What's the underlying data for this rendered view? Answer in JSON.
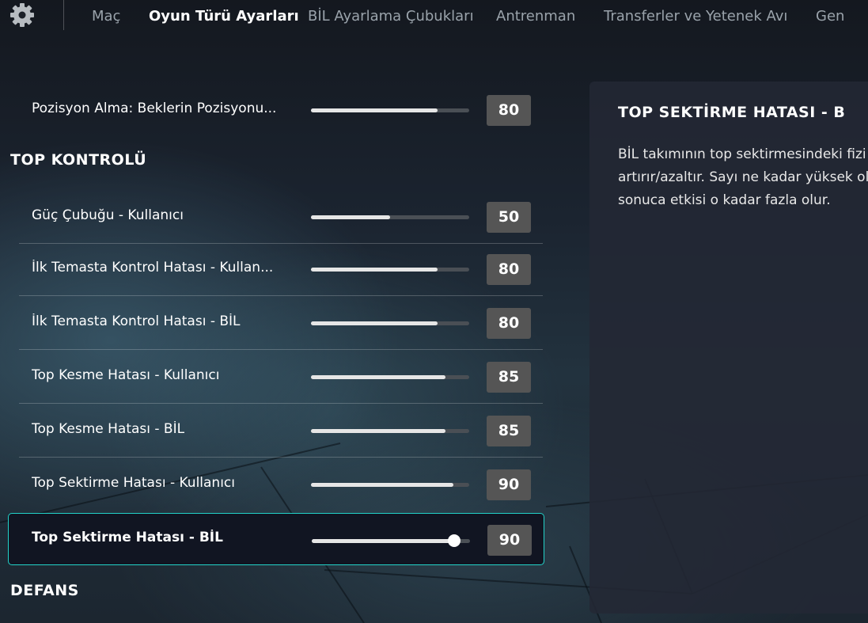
{
  "nav": {
    "tabs": [
      {
        "label": "Maç",
        "active": false
      },
      {
        "label": "Oyun Türü Ayarları",
        "active": true
      },
      {
        "label": "BİL Ayarlama Çubukları",
        "active": false
      },
      {
        "label": "Antrenman",
        "active": false
      },
      {
        "label": "Transferler ve Yetenek Avı",
        "active": false
      },
      {
        "label": "Gen",
        "active": false
      }
    ],
    "settings_icon": "gear-icon"
  },
  "settings": {
    "top_row": {
      "label": "Pozisyon Alma: Beklerin Pozisyonu...",
      "value": 80
    },
    "sections": [
      {
        "title": "TOP KONTROLÜ",
        "rows": [
          {
            "label": "Güç Çubuğu - Kullanıcı",
            "value": 50
          },
          {
            "label": "İlk Temasta Kontrol Hatası - Kullan...",
            "value": 80
          },
          {
            "label": "İlk Temasta Kontrol Hatası - BİL",
            "value": 80
          },
          {
            "label": "Top Kesme Hatası - Kullanıcı",
            "value": 85
          },
          {
            "label": "Top Kesme Hatası - BİL",
            "value": 85
          },
          {
            "label": "Top Sektirme Hatası - Kullanıcı",
            "value": 90
          },
          {
            "label": "Top Sektirme Hatası - BİL",
            "value": 90,
            "selected": true
          }
        ]
      },
      {
        "title": "DEFANS",
        "rows": []
      }
    ]
  },
  "info_panel": {
    "title": "TOP SEKTİRME HATASI - B",
    "description": "BİL takımının top sektirmesindeki fizi\nartırır/azaltır. Sayı ne kadar yüksek ol\nsonuca etkisi o kadar fazla olur."
  },
  "colors": {
    "accent": "#22d2c8",
    "value_box": "#555555",
    "slider_fill": "#e6e6e6",
    "slider_track": "#4a4f55"
  }
}
